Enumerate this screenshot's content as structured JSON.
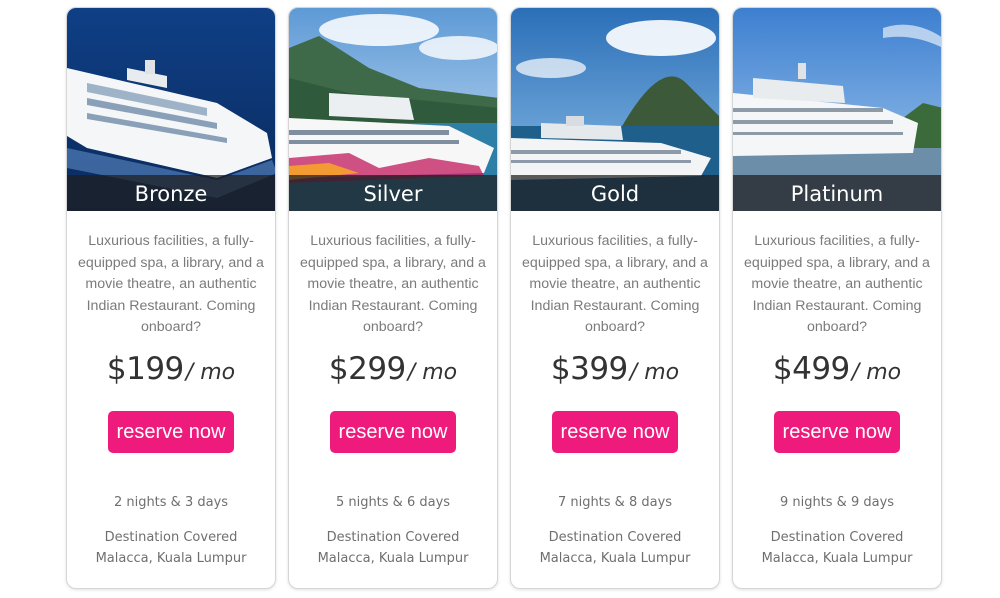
{
  "plans": [
    {
      "tier": "Bronze",
      "description": "Luxurious facilities, a fully-equipped spa, a library, and a movie theatre, an authentic Indian Restaurant. Coming onboard?",
      "price": "$199",
      "period": "/ mo",
      "button": "reserve now",
      "duration": "2 nights & 3 days",
      "destination_label": "Destination Covered",
      "destination": "Malacca, Kuala Lumpur"
    },
    {
      "tier": "Silver",
      "description": "Luxurious facilities, a fully-equipped spa, a library, and a movie theatre, an authentic Indian Restaurant. Coming onboard?",
      "price": "$299",
      "period": "/ mo",
      "button": "reserve now",
      "duration": "5 nights & 6 days",
      "destination_label": "Destination Covered",
      "destination": "Malacca, Kuala Lumpur"
    },
    {
      "tier": "Gold",
      "description": "Luxurious facilities, a fully-equipped spa, a library, and a movie theatre, an authentic Indian Restaurant. Coming onboard?",
      "price": "$399",
      "period": "/ mo",
      "button": "reserve now",
      "duration": "7 nights & 8 days",
      "destination_label": "Destination Covered",
      "destination": "Malacca, Kuala Lumpur"
    },
    {
      "tier": "Platinum",
      "description": "Luxurious facilities, a fully-equipped spa, a library, and a movie theatre, an authentic Indian Restaurant. Coming onboard?",
      "price": "$499",
      "period": "/ mo",
      "button": "reserve now",
      "duration": "9 nights & 9 days",
      "destination_label": "Destination Covered",
      "destination": "Malacca, Kuala Lumpur"
    }
  ],
  "colors": {
    "button": "#ee1a7c",
    "text_muted": "#7b7b7b",
    "price": "#333333"
  }
}
